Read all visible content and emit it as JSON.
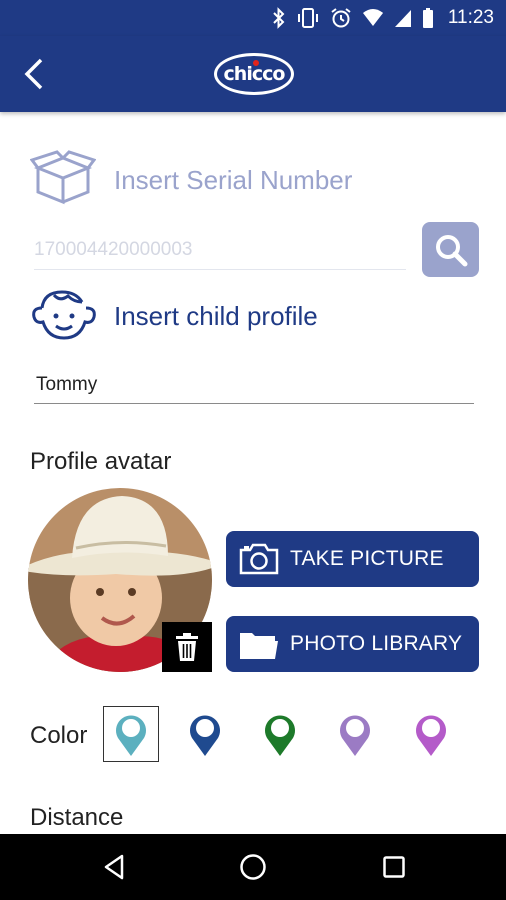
{
  "status_bar": {
    "time": "11:23"
  },
  "app_bar": {
    "logo_text": "chicco"
  },
  "serial": {
    "label": "Insert Serial Number",
    "placeholder": "170004420000003"
  },
  "child_profile": {
    "label": "Insert child profile",
    "name_value": "Tommy"
  },
  "avatar_section": {
    "label": "Profile avatar",
    "take_picture_label": "TAKE PICTURE",
    "photo_library_label": "PHOTO LIBRARY"
  },
  "color_section": {
    "label": "Color",
    "options": [
      {
        "color": "#5cb0bf",
        "selected": true
      },
      {
        "color": "#1f4a8f",
        "selected": false
      },
      {
        "color": "#1d7a2a",
        "selected": false
      },
      {
        "color": "#9b7bc4",
        "selected": false
      },
      {
        "color": "#b45bc9",
        "selected": false
      }
    ]
  },
  "distance_section": {
    "label": "Distance"
  },
  "colors": {
    "primary": "#1f3a85",
    "muted": "#9aa3cc"
  }
}
